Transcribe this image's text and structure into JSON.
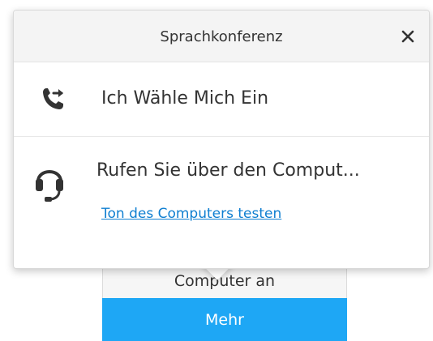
{
  "popover": {
    "title": "Sprachkonferenz",
    "dial_in_label": "Ich Wähle Mich Ein",
    "computer_label": "Rufen Sie über den Comput...",
    "test_link": "Ton des Computers testen"
  },
  "menu": {
    "computer_item": "Computer an",
    "more_item": "Mehr"
  },
  "colors": {
    "accent": "#1ea7f5",
    "link": "#0f7fd1",
    "header_bg": "#f4f4f4"
  },
  "icons": {
    "close": "close-icon",
    "dial_in": "phone-forward-icon",
    "headset": "headset-icon"
  }
}
